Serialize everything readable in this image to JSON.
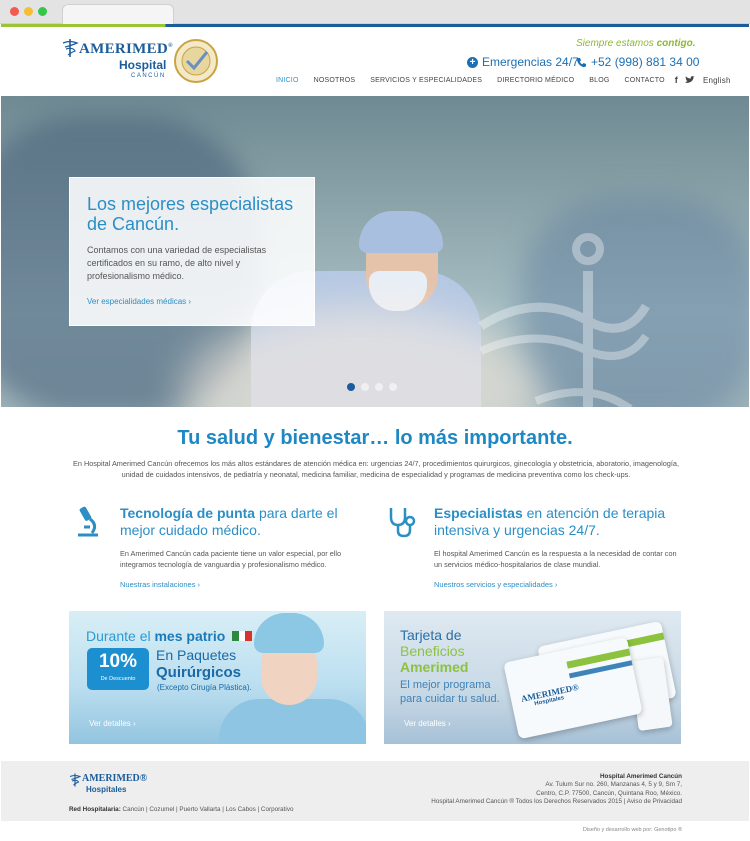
{
  "colors": {
    "brand_blue": "#1b5c9b",
    "accent_blue": "#2b8fc6",
    "accent_green": "#8cb833"
  },
  "header": {
    "logo_name": "AMERIMED",
    "logo_reg": "®",
    "logo_hospital": "Hospital",
    "logo_city": "CANCÚN",
    "tagline_prefix": "Siempre estamos ",
    "tagline_bold": "contigo.",
    "emergency": "Emergencias 24/7",
    "phone": "+52 (998) 881 34 00",
    "nav": [
      "INICIO",
      "NOSOTROS",
      "SERVICIOS Y ESPECIALIDADES",
      "DIRECTORIO MÉDICO",
      "BLOG",
      "CONTACTO"
    ],
    "social_fb": "f",
    "social_tw": "t",
    "language": "English"
  },
  "hero": {
    "title": "Los mejores especialistas de Cancún.",
    "text": "Contamos con una variedad de especialistas certificados en su ramo, de alto nivel y profesionalismo médico.",
    "link": "Ver especialidades médicas  ›",
    "slides_active": 1,
    "slides_total": 4
  },
  "intro": {
    "title": "Tu salud y bienestar… lo más importante.",
    "text": "En Hospital Amerimed Cancún ofrecemos los más altos estándares de atención médica en: urgencias 24/7, procedimientos quirurgicos, ginecología y obstetricia, aboratorio, imagenología, unidad de cuidados intensivos, de pediatría y neonatal, medicina familiar, medicina de especialidad y programas de medicina preventiva como los check-ups."
  },
  "features": [
    {
      "icon": "microscope-icon",
      "title_bold": "Tecnología de punta",
      "title_rest": " para darte el mejor cuidado médico.",
      "text": "En Amerimed Cancún cada paciente tiene un valor especial, por ello integramos tecnología de vanguardia y profesionalismo médico.",
      "link": "Nuestras instalaciones  ›"
    },
    {
      "icon": "stethoscope-icon",
      "title_bold": "Especialistas",
      "title_rest": " en atención de terapia intensiva y urgencias 24/7.",
      "text": "El hospital Amerimed Cancún es la respuesta a la necesidad de contar con un servicios médico-hospitalarios de clase mundial.",
      "link": "Nuestros servicios y especialidades  ›"
    }
  ],
  "promos": {
    "surgery": {
      "line1_prefix": "Durante el ",
      "line1_bold": "mes patrio",
      "badge_pct": "10%",
      "badge_text": "De Descuento",
      "line2": "En Paquetes",
      "line3": "Quirúrgicos",
      "note": "(Excepto Cirugía Plástica).",
      "link": "Ver detalles  ›"
    },
    "card": {
      "line1": "Tarjeta de",
      "line2": "Beneficios",
      "line3": "Amerimed",
      "line4": "El mejor programa",
      "line5": "para cuidar tu salud.",
      "card_brand": "AMERIMED®",
      "card_brand_sub": "Hospitales",
      "link": "Ver detalles  ›"
    }
  },
  "footer": {
    "logo_name": "AMERIMED®",
    "logo_sub": "Hospitales",
    "network_label": "Red Hospitalaria:",
    "network": " Cancún | Cozumel | Puerto Vallarta | Los Cabos | Corporativo",
    "address_head": "Hospital Amerimed Cancún",
    "address1": "Av. Tulum Sur no. 260, Manzanas 4, 5 y 9, Sm 7,",
    "address2": "Centro, C.P. 77500, Cancún, Quintana Roo, México.",
    "rights": "Hospital Amerimed Cancún ® Todos los Derechos Reservados 2015 | Aviso de Privacidad",
    "credit": "Diseño y desarrollo web por: Genotipo ®"
  }
}
